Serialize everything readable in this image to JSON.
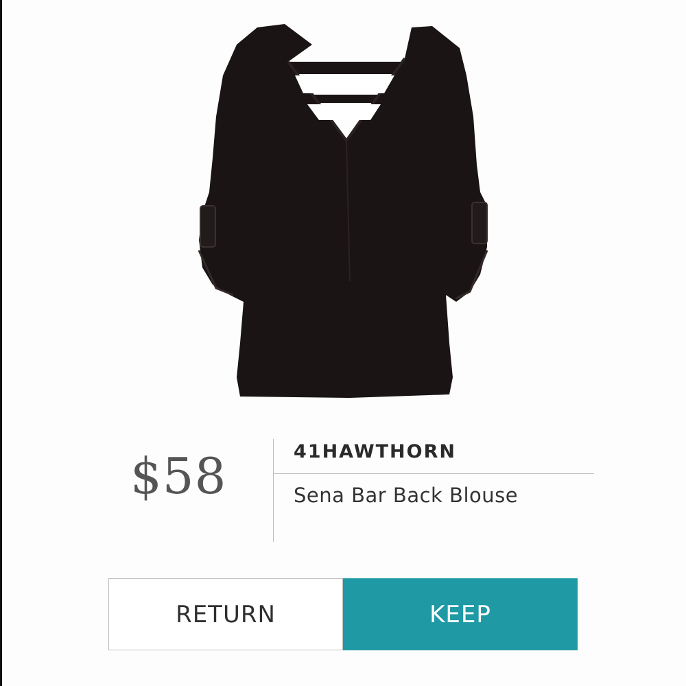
{
  "product": {
    "image_icon": "black-blouse-icon",
    "price": "$58",
    "brand": "41HAWTHORN",
    "name": "Sena Bar Back Blouse"
  },
  "actions": {
    "return_label": "RETURN",
    "keep_label": "KEEP"
  },
  "colors": {
    "accent": "#1f9aa5",
    "price_text": "#555555",
    "garment": "#1a1414"
  }
}
